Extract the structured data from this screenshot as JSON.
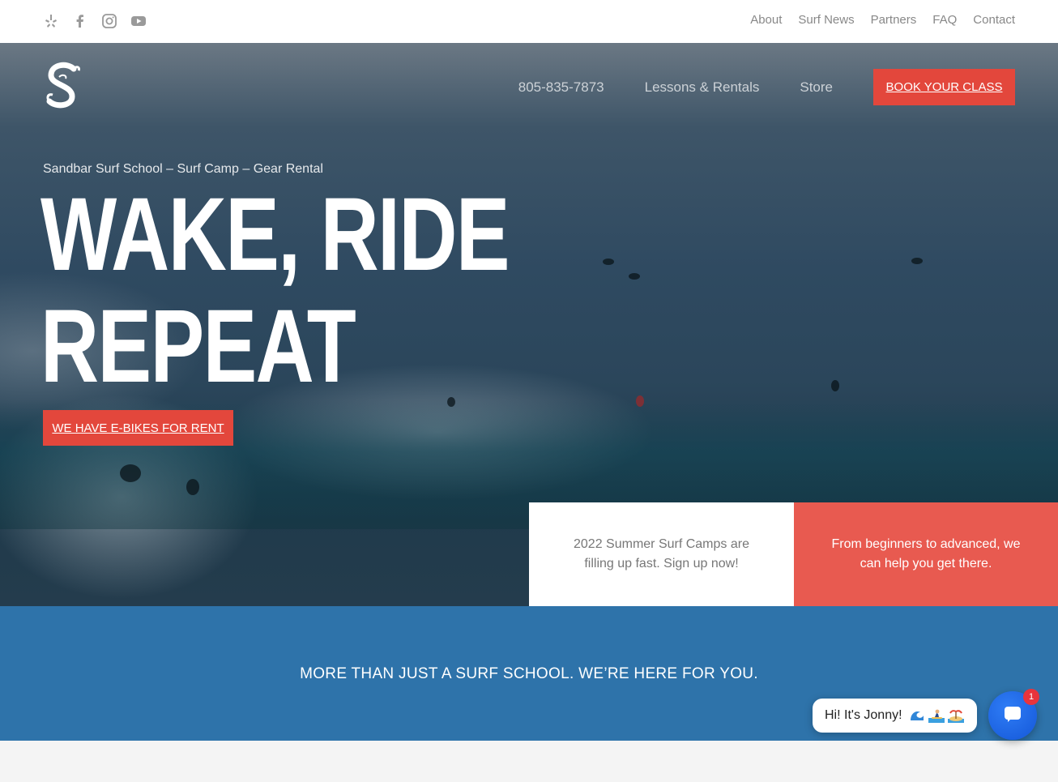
{
  "topbar": {
    "social": [
      "yelp-icon",
      "facebook-icon",
      "instagram-icon",
      "youtube-icon"
    ],
    "nav": [
      "About",
      "Surf News",
      "Partners",
      "FAQ",
      "Contact"
    ]
  },
  "header": {
    "logo_icon": "sandbar-s-logo",
    "nav": [
      "805-835-7873",
      "Lessons & Rentals",
      "Store"
    ],
    "book_label": "BOOK YOUR CLASS"
  },
  "hero": {
    "tagline": "Sandbar Surf School – Surf Camp – Gear Rental",
    "headline_line1": "WAKE, RIDE",
    "headline_line2": "REPEAT",
    "ebike_label": "WE HAVE E-BIKES FOR RENT"
  },
  "cards": {
    "white_text": "2022 Summer Surf Camps are filling up fast. Sign up now!",
    "red_text": "From beginners to advanced, we can help you get there."
  },
  "band": {
    "message": "MORE THAN JUST A SURF SCHOOL. WE’RE HERE FOR YOU."
  },
  "chat": {
    "greeting": "Hi! It's Jonny!",
    "emoji_icons": [
      "wave-emoji",
      "surfer-emoji",
      "island-emoji"
    ],
    "badge_count": "1"
  },
  "colors": {
    "accent_red": "#e3473c",
    "band_blue": "#2e73aa",
    "chat_blue": "#1a66e8"
  }
}
